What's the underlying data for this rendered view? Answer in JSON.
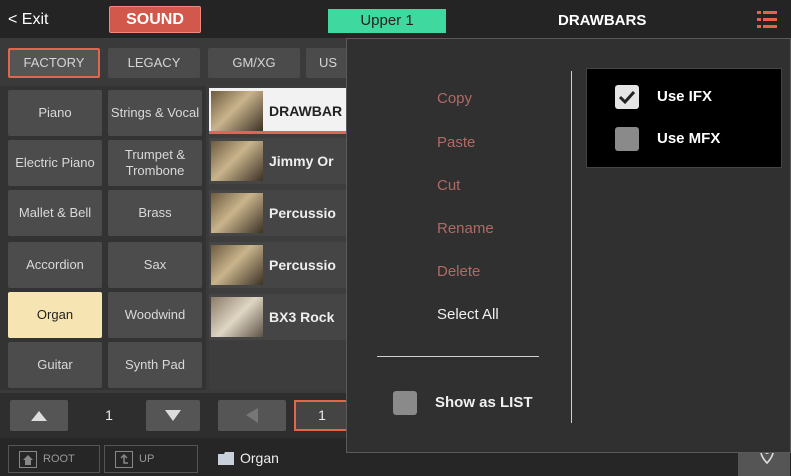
{
  "topbar": {
    "exit_label": "< Exit",
    "sound_label": "SOUND",
    "upper_label": "Upper 1",
    "title": "DRAWBARS"
  },
  "tabs": [
    "FACTORY",
    "LEGACY",
    "GM/XG",
    "US"
  ],
  "categories": [
    {
      "left": "Piano",
      "right": "Strings & Vocal"
    },
    {
      "left": "Electric Piano",
      "right": "Trumpet & Trombone"
    },
    {
      "left": "Mallet & Bell",
      "right": "Brass"
    },
    {
      "left": "Accordion",
      "right": "Sax"
    },
    {
      "left": "Organ",
      "right": "Woodwind"
    },
    {
      "left": "Guitar",
      "right": "Synth Pad"
    }
  ],
  "sounds": [
    {
      "name": "DRAWBAR"
    },
    {
      "name": "Jimmy Or"
    },
    {
      "name": "Percussio"
    },
    {
      "name": "Percussio"
    },
    {
      "name": "BX3 Rock"
    }
  ],
  "category_pager": {
    "page": "1"
  },
  "sound_pager": {
    "page": "1"
  },
  "footer": {
    "root_label": "ROOT",
    "up_label": "UP",
    "folder_name": "Organ"
  },
  "menu": {
    "copy": "Copy",
    "paste": "Paste",
    "cut": "Cut",
    "rename": "Rename",
    "delete": "Delete",
    "select_all": "Select All",
    "show_as_list": "Show as LIST"
  },
  "fx": {
    "use_ifx": "Use IFX",
    "use_mfx": "Use MFX",
    "use_ifx_checked": true,
    "use_mfx_checked": false
  },
  "colors": {
    "accent": "#e0664c",
    "upper_badge": "#3fd9a0",
    "sound_button": "#d2584b",
    "selected_category": "#f6e5b3"
  }
}
